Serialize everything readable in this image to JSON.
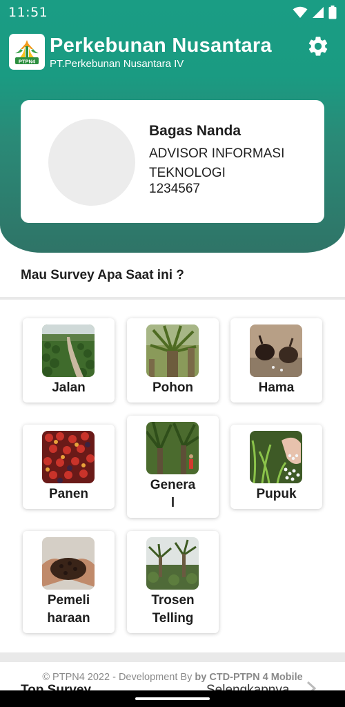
{
  "status_bar": {
    "time": "11:51"
  },
  "app_bar": {
    "title": "Perkebunan Nusantara",
    "subtitle": "PT.Perkebunan Nusantara IV",
    "logo_text": "PTPN4"
  },
  "profile": {
    "name": "Bagas Nanda",
    "role": "ADVISOR INFORMASI TEKNOLOGI",
    "id": "1234567"
  },
  "survey": {
    "title": "Mau Survey Apa Saat ini ?",
    "items": [
      {
        "label": "Jalan"
      },
      {
        "label": "Pohon"
      },
      {
        "label": "Hama"
      },
      {
        "label": "Panen"
      },
      {
        "label": "Genera l"
      },
      {
        "label": "Pupuk"
      },
      {
        "label": "Pemeli haraan"
      },
      {
        "label": "Trosen Telling"
      }
    ]
  },
  "footer": {
    "prefix": "© PTPN4 2022 - Development By ",
    "bold": "by CTD-PTPN 4 Mobile"
  },
  "top_survey": {
    "title": "Top Survey",
    "more_label": "Selengkapnya"
  },
  "colors": {
    "primary": "#1a9d84",
    "primary_dark": "#2f7467"
  }
}
